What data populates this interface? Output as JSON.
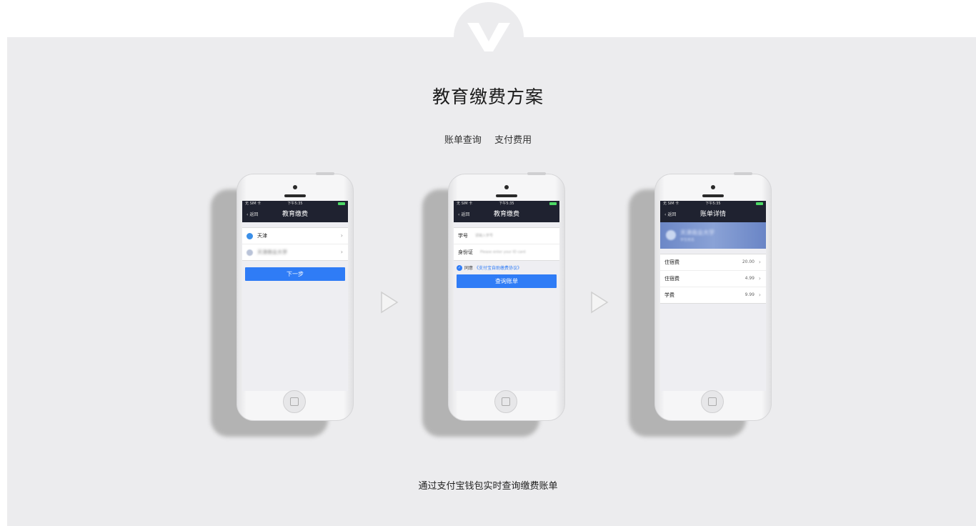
{
  "page": {
    "title": "教育缴费方案",
    "tabs": [
      "账单查询",
      "支付费用"
    ],
    "footer": "通过支付宝钱包实时查询缴费账单"
  },
  "phones": [
    {
      "status": {
        "carrier": "无 SIM 卡",
        "time": "下午5:35"
      },
      "nav": {
        "back": "返回",
        "title": "教育缴费"
      },
      "list": [
        {
          "label": "天津",
          "icon": "location-pin-icon"
        },
        {
          "label": "天津商业大学",
          "icon": "school-icon"
        }
      ],
      "button": "下一步"
    },
    {
      "status": {
        "carrier": "无 SIM 卡",
        "time": "下午5:35"
      },
      "nav": {
        "back": "返回",
        "title": "教育缴费"
      },
      "fields": [
        {
          "label": "学号",
          "placeholder": "请输入学号"
        },
        {
          "label": "身份证",
          "placeholder": "Please enter your ID card"
        }
      ],
      "agree": {
        "prefix": "同意",
        "link": "《支付宝自助缴费协议》"
      },
      "button": "查询账单"
    },
    {
      "status": {
        "carrier": "无 SIM 卡",
        "time": "下午5:35"
      },
      "nav": {
        "back": "返回",
        "title": "账单详情"
      },
      "banner": {
        "name": "天津商业大学",
        "sub": "学生姓名"
      },
      "fees": [
        {
          "label": "住宿费",
          "amount": "20.00"
        },
        {
          "label": "住宿费",
          "amount": "4.99"
        },
        {
          "label": "学费",
          "amount": "9.99"
        }
      ]
    }
  ],
  "colors": {
    "accent": "#2f7cf6",
    "navbar": "#1f2230",
    "panel_bg": "#ececee"
  }
}
